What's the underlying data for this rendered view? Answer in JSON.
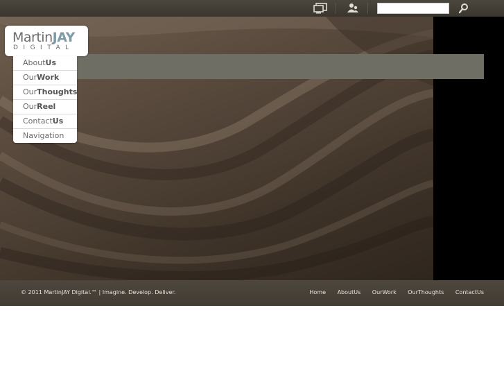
{
  "topbar": {
    "search": {
      "value": "",
      "placeholder": ""
    },
    "icons": [
      "screen-icon",
      "people-icon",
      "search-icon"
    ]
  },
  "logo": {
    "part1": "Martin",
    "part2": "JAY",
    "line2": "DIGITAL"
  },
  "menu": {
    "items": [
      {
        "normal": "About",
        "bold": "Us"
      },
      {
        "normal": "Our",
        "bold": "Work"
      },
      {
        "normal": "Our",
        "bold": "Thoughts"
      },
      {
        "normal": "Our",
        "bold": "Reel"
      },
      {
        "normal": "Contact",
        "bold": "Us"
      }
    ],
    "footer_label": "Navigation"
  },
  "footer": {
    "copyright": "© 2011 MartinJAY Digital.™ | Imagine. Develop. Deliver.",
    "links": [
      "Home",
      "AboutUs",
      "OurWork",
      "OurThoughts",
      "ContactUs"
    ]
  },
  "colors": {
    "topbar": "#433e36",
    "accent_blue": "#7f9ba7",
    "grey_bar": "#6f6e64",
    "footer": "#47413a"
  }
}
